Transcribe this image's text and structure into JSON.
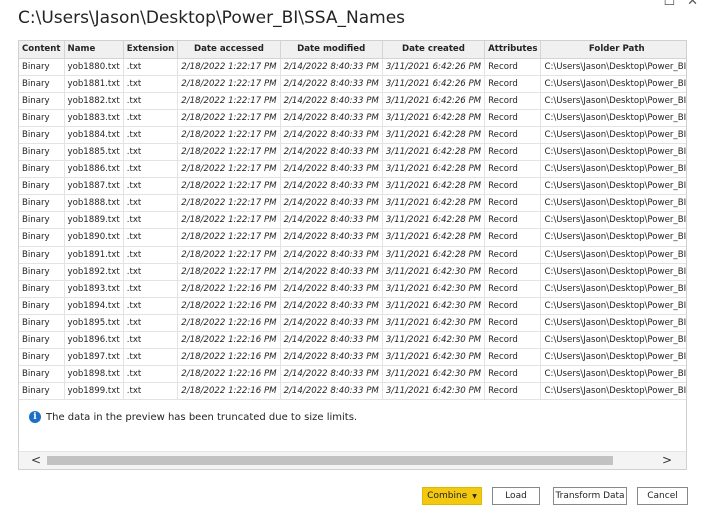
{
  "window": {
    "title": "C:\\Users\\Jason\\Desktop\\Power_BI\\SSA_Names",
    "restore_glyph": "☐",
    "close_glyph": "✕"
  },
  "table": {
    "columns": [
      "Content",
      "Name",
      "Extension",
      "Date accessed",
      "Date modified",
      "Date created",
      "Attributes",
      "Folder Path"
    ],
    "rows": [
      [
        "Binary",
        "yob1880.txt",
        ".txt",
        "2/18/2022 1:22:17 PM",
        "2/14/2022 8:40:33 PM",
        "3/11/2021 6:42:26 PM",
        "Record",
        "C:\\Users\\Jason\\Desktop\\Power_BI\\"
      ],
      [
        "Binary",
        "yob1881.txt",
        ".txt",
        "2/18/2022 1:22:17 PM",
        "2/14/2022 8:40:33 PM",
        "3/11/2021 6:42:26 PM",
        "Record",
        "C:\\Users\\Jason\\Desktop\\Power_BI\\"
      ],
      [
        "Binary",
        "yob1882.txt",
        ".txt",
        "2/18/2022 1:22:17 PM",
        "2/14/2022 8:40:33 PM",
        "3/11/2021 6:42:26 PM",
        "Record",
        "C:\\Users\\Jason\\Desktop\\Power_BI\\"
      ],
      [
        "Binary",
        "yob1883.txt",
        ".txt",
        "2/18/2022 1:22:17 PM",
        "2/14/2022 8:40:33 PM",
        "3/11/2021 6:42:28 PM",
        "Record",
        "C:\\Users\\Jason\\Desktop\\Power_BI\\"
      ],
      [
        "Binary",
        "yob1884.txt",
        ".txt",
        "2/18/2022 1:22:17 PM",
        "2/14/2022 8:40:33 PM",
        "3/11/2021 6:42:28 PM",
        "Record",
        "C:\\Users\\Jason\\Desktop\\Power_BI\\"
      ],
      [
        "Binary",
        "yob1885.txt",
        ".txt",
        "2/18/2022 1:22:17 PM",
        "2/14/2022 8:40:33 PM",
        "3/11/2021 6:42:28 PM",
        "Record",
        "C:\\Users\\Jason\\Desktop\\Power_BI\\"
      ],
      [
        "Binary",
        "yob1886.txt",
        ".txt",
        "2/18/2022 1:22:17 PM",
        "2/14/2022 8:40:33 PM",
        "3/11/2021 6:42:28 PM",
        "Record",
        "C:\\Users\\Jason\\Desktop\\Power_BI\\"
      ],
      [
        "Binary",
        "yob1887.txt",
        ".txt",
        "2/18/2022 1:22:17 PM",
        "2/14/2022 8:40:33 PM",
        "3/11/2021 6:42:28 PM",
        "Record",
        "C:\\Users\\Jason\\Desktop\\Power_BI\\"
      ],
      [
        "Binary",
        "yob1888.txt",
        ".txt",
        "2/18/2022 1:22:17 PM",
        "2/14/2022 8:40:33 PM",
        "3/11/2021 6:42:28 PM",
        "Record",
        "C:\\Users\\Jason\\Desktop\\Power_BI\\"
      ],
      [
        "Binary",
        "yob1889.txt",
        ".txt",
        "2/18/2022 1:22:17 PM",
        "2/14/2022 8:40:33 PM",
        "3/11/2021 6:42:28 PM",
        "Record",
        "C:\\Users\\Jason\\Desktop\\Power_BI\\"
      ],
      [
        "Binary",
        "yob1890.txt",
        ".txt",
        "2/18/2022 1:22:17 PM",
        "2/14/2022 8:40:33 PM",
        "3/11/2021 6:42:28 PM",
        "Record",
        "C:\\Users\\Jason\\Desktop\\Power_BI\\"
      ],
      [
        "Binary",
        "yob1891.txt",
        ".txt",
        "2/18/2022 1:22:17 PM",
        "2/14/2022 8:40:33 PM",
        "3/11/2021 6:42:28 PM",
        "Record",
        "C:\\Users\\Jason\\Desktop\\Power_BI\\"
      ],
      [
        "Binary",
        "yob1892.txt",
        ".txt",
        "2/18/2022 1:22:17 PM",
        "2/14/2022 8:40:33 PM",
        "3/11/2021 6:42:30 PM",
        "Record",
        "C:\\Users\\Jason\\Desktop\\Power_BI\\"
      ],
      [
        "Binary",
        "yob1893.txt",
        ".txt",
        "2/18/2022 1:22:16 PM",
        "2/14/2022 8:40:33 PM",
        "3/11/2021 6:42:30 PM",
        "Record",
        "C:\\Users\\Jason\\Desktop\\Power_BI\\"
      ],
      [
        "Binary",
        "yob1894.txt",
        ".txt",
        "2/18/2022 1:22:16 PM",
        "2/14/2022 8:40:33 PM",
        "3/11/2021 6:42:30 PM",
        "Record",
        "C:\\Users\\Jason\\Desktop\\Power_BI\\"
      ],
      [
        "Binary",
        "yob1895.txt",
        ".txt",
        "2/18/2022 1:22:16 PM",
        "2/14/2022 8:40:33 PM",
        "3/11/2021 6:42:30 PM",
        "Record",
        "C:\\Users\\Jason\\Desktop\\Power_BI\\"
      ],
      [
        "Binary",
        "yob1896.txt",
        ".txt",
        "2/18/2022 1:22:16 PM",
        "2/14/2022 8:40:33 PM",
        "3/11/2021 6:42:30 PM",
        "Record",
        "C:\\Users\\Jason\\Desktop\\Power_BI\\"
      ],
      [
        "Binary",
        "yob1897.txt",
        ".txt",
        "2/18/2022 1:22:16 PM",
        "2/14/2022 8:40:33 PM",
        "3/11/2021 6:42:30 PM",
        "Record",
        "C:\\Users\\Jason\\Desktop\\Power_BI\\"
      ],
      [
        "Binary",
        "yob1898.txt",
        ".txt",
        "2/18/2022 1:22:16 PM",
        "2/14/2022 8:40:33 PM",
        "3/11/2021 6:42:30 PM",
        "Record",
        "C:\\Users\\Jason\\Desktop\\Power_BI\\"
      ],
      [
        "Binary",
        "yob1899.txt",
        ".txt",
        "2/18/2022 1:22:16 PM",
        "2/14/2022 8:40:33 PM",
        "3/11/2021 6:42:30 PM",
        "Record",
        "C:\\Users\\Jason\\Desktop\\Power_BI\\"
      ]
    ]
  },
  "notice": {
    "icon": "info-icon",
    "text": "The data in the preview has been truncated due to size limits."
  },
  "scrollbar": {
    "left_arrow": "<",
    "right_arrow": ">"
  },
  "buttons": {
    "combine": "Combine",
    "combine_caret": "▼",
    "load": "Load",
    "transform": "Transform Data",
    "cancel": "Cancel"
  },
  "colors": {
    "primary_button": "#f2c811",
    "info_icon": "#1d6fc5",
    "header_bg": "#f0f0f0"
  }
}
